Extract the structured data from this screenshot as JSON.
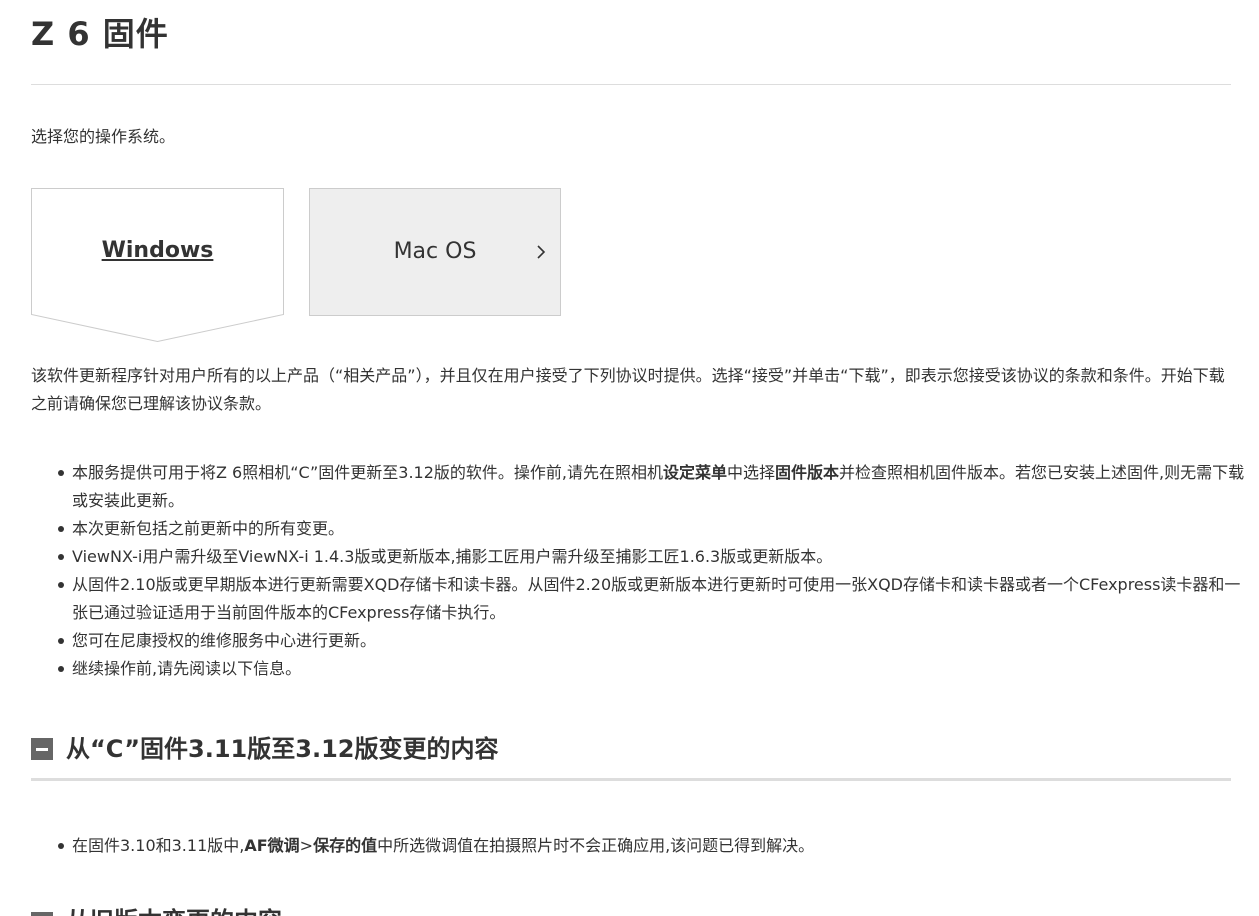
{
  "header": {
    "title": "Z 6 固件"
  },
  "os_select": {
    "prompt": "选择您的操作系统。",
    "tabs": [
      {
        "label": "Windows",
        "selected": true
      },
      {
        "label": "Mac OS",
        "selected": false
      }
    ]
  },
  "agreement": {
    "text": "该软件更新程序针对用户所有的以上产品（“相关产品”），并且仅在用户接受了下列协议时提供。选择“接受”并单击“下载”，即表示您接受该协议的条款和条件。开始下载之前请确保您已理解该协议条款。"
  },
  "notes": {
    "item1": {
      "pre": "本服务提供可用于将Z 6照相机“C”固件更新至3.12版的软件。操作前,请先在照相机",
      "bold1": "设定菜单",
      "mid": "中选择",
      "bold2": "固件版本",
      "post": "并检查照相机固件版本。若您已安装上述固件,则无需下载或安装此更新。"
    },
    "item2": "本次更新包括之前更新中的所有变更。",
    "item3": "ViewNX-i用户需升级至ViewNX-i 1.4.3版或更新版本,捕影工匠用户需升级至捕影工匠1.6.3版或更新版本。",
    "item4": "从固件2.10版或更早期版本进行更新需要XQD存储卡和读卡器。从固件2.20版或更新版本进行更新时可使用一张XQD存储卡和读卡器或者一个CFexpress读卡器和一张已通过验证适用于当前固件版本的CFexpress存储卡执行。",
    "item5": "您可在尼康授权的维修服务中心进行更新。",
    "item6": "继续操作前,请先阅读以下信息。"
  },
  "changes_section": {
    "heading": "从“C”固件3.11版至3.12版变更的内容",
    "item1": {
      "pre": "在固件3.10和3.11版中,",
      "bold1": "AF微调",
      "sep": ">",
      "bold2": "保存的值",
      "post": "中所选微调值在拍摄照片时不会正确应用,该问题已得到解决。"
    }
  },
  "next_section": {
    "heading": "从旧版本变更的内容"
  }
}
